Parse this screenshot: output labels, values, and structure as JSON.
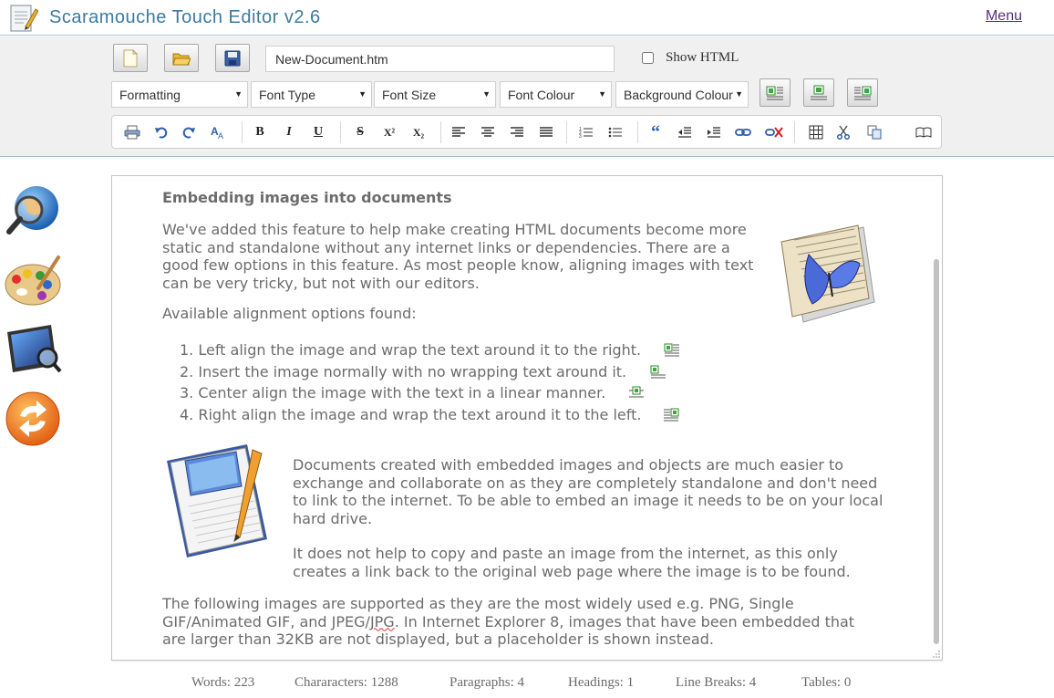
{
  "app": {
    "title": "Scaramouche Touch Editor v2.6",
    "menu_label": "Menu"
  },
  "file": {
    "filename": "New-Document.htm",
    "show_html_label": "Show HTML",
    "show_html_checked": false
  },
  "dropdowns": {
    "formatting": "Formatting",
    "font_type": "Font Type",
    "font_size": "Font Size",
    "font_colour": "Font Colour",
    "background_colour": "Background Colour"
  },
  "format_toolbar": {
    "bold": "B",
    "italic": "I",
    "underline": "U",
    "strikethrough": "S",
    "superscript": "X²",
    "subscript": "X₂"
  },
  "document": {
    "heading": "Embedding images into documents",
    "para1_lines": [
      "We've added this feature to help make creating HTML documents become more",
      "static and standalone without any internet links or dependencies. There are a",
      "good few options in this feature. As most people know, aligning images with text",
      "can be very tricky, but not with our editors."
    ],
    "options_intro": "Available alignment options found:",
    "options": [
      "1. Left align the image and wrap the text around it to the right.",
      "2. Insert the image normally with no wrapping text around it.",
      "3. Center align the image with the text in a linear manner.",
      "4. Right align the image and wrap the text around it to the left."
    ],
    "para2_lines": [
      "Documents created with embedded images and objects are much easier to",
      "exchange and collaborate on as they are completely standalone and don't need",
      "to link to the internet. To be able to embed an image it needs to be on your local",
      "hard drive."
    ],
    "para3_lines": [
      "It does not help to copy and paste an image from the internet, as this only",
      "creates a link back to the original web page where the image is to be found."
    ],
    "para4_line1": "The following images are supported as they are the most widely used e.g. PNG, Single",
    "para4_line2_pre": "GIF/Animated GIF, and JPEG/",
    "para4_line2_spell": "JPG",
    "para4_line2_post": ". In Internet Explorer 8, images that have been embedded that",
    "para4_line3": "are larger than 32KB are not displayed, but a placeholder is shown instead."
  },
  "status": {
    "words": "Words: 223",
    "characters": "Chararacters: 1288",
    "paragraphs": "Paragraphs: 4",
    "headings": "Headings: 1",
    "line_breaks": "Line Breaks: 4",
    "tables": "Tables: 0"
  },
  "colors": {
    "title": "#3c7aa0",
    "accent_orange": "#f08a1c",
    "text_gray": "#6c6c6c"
  }
}
